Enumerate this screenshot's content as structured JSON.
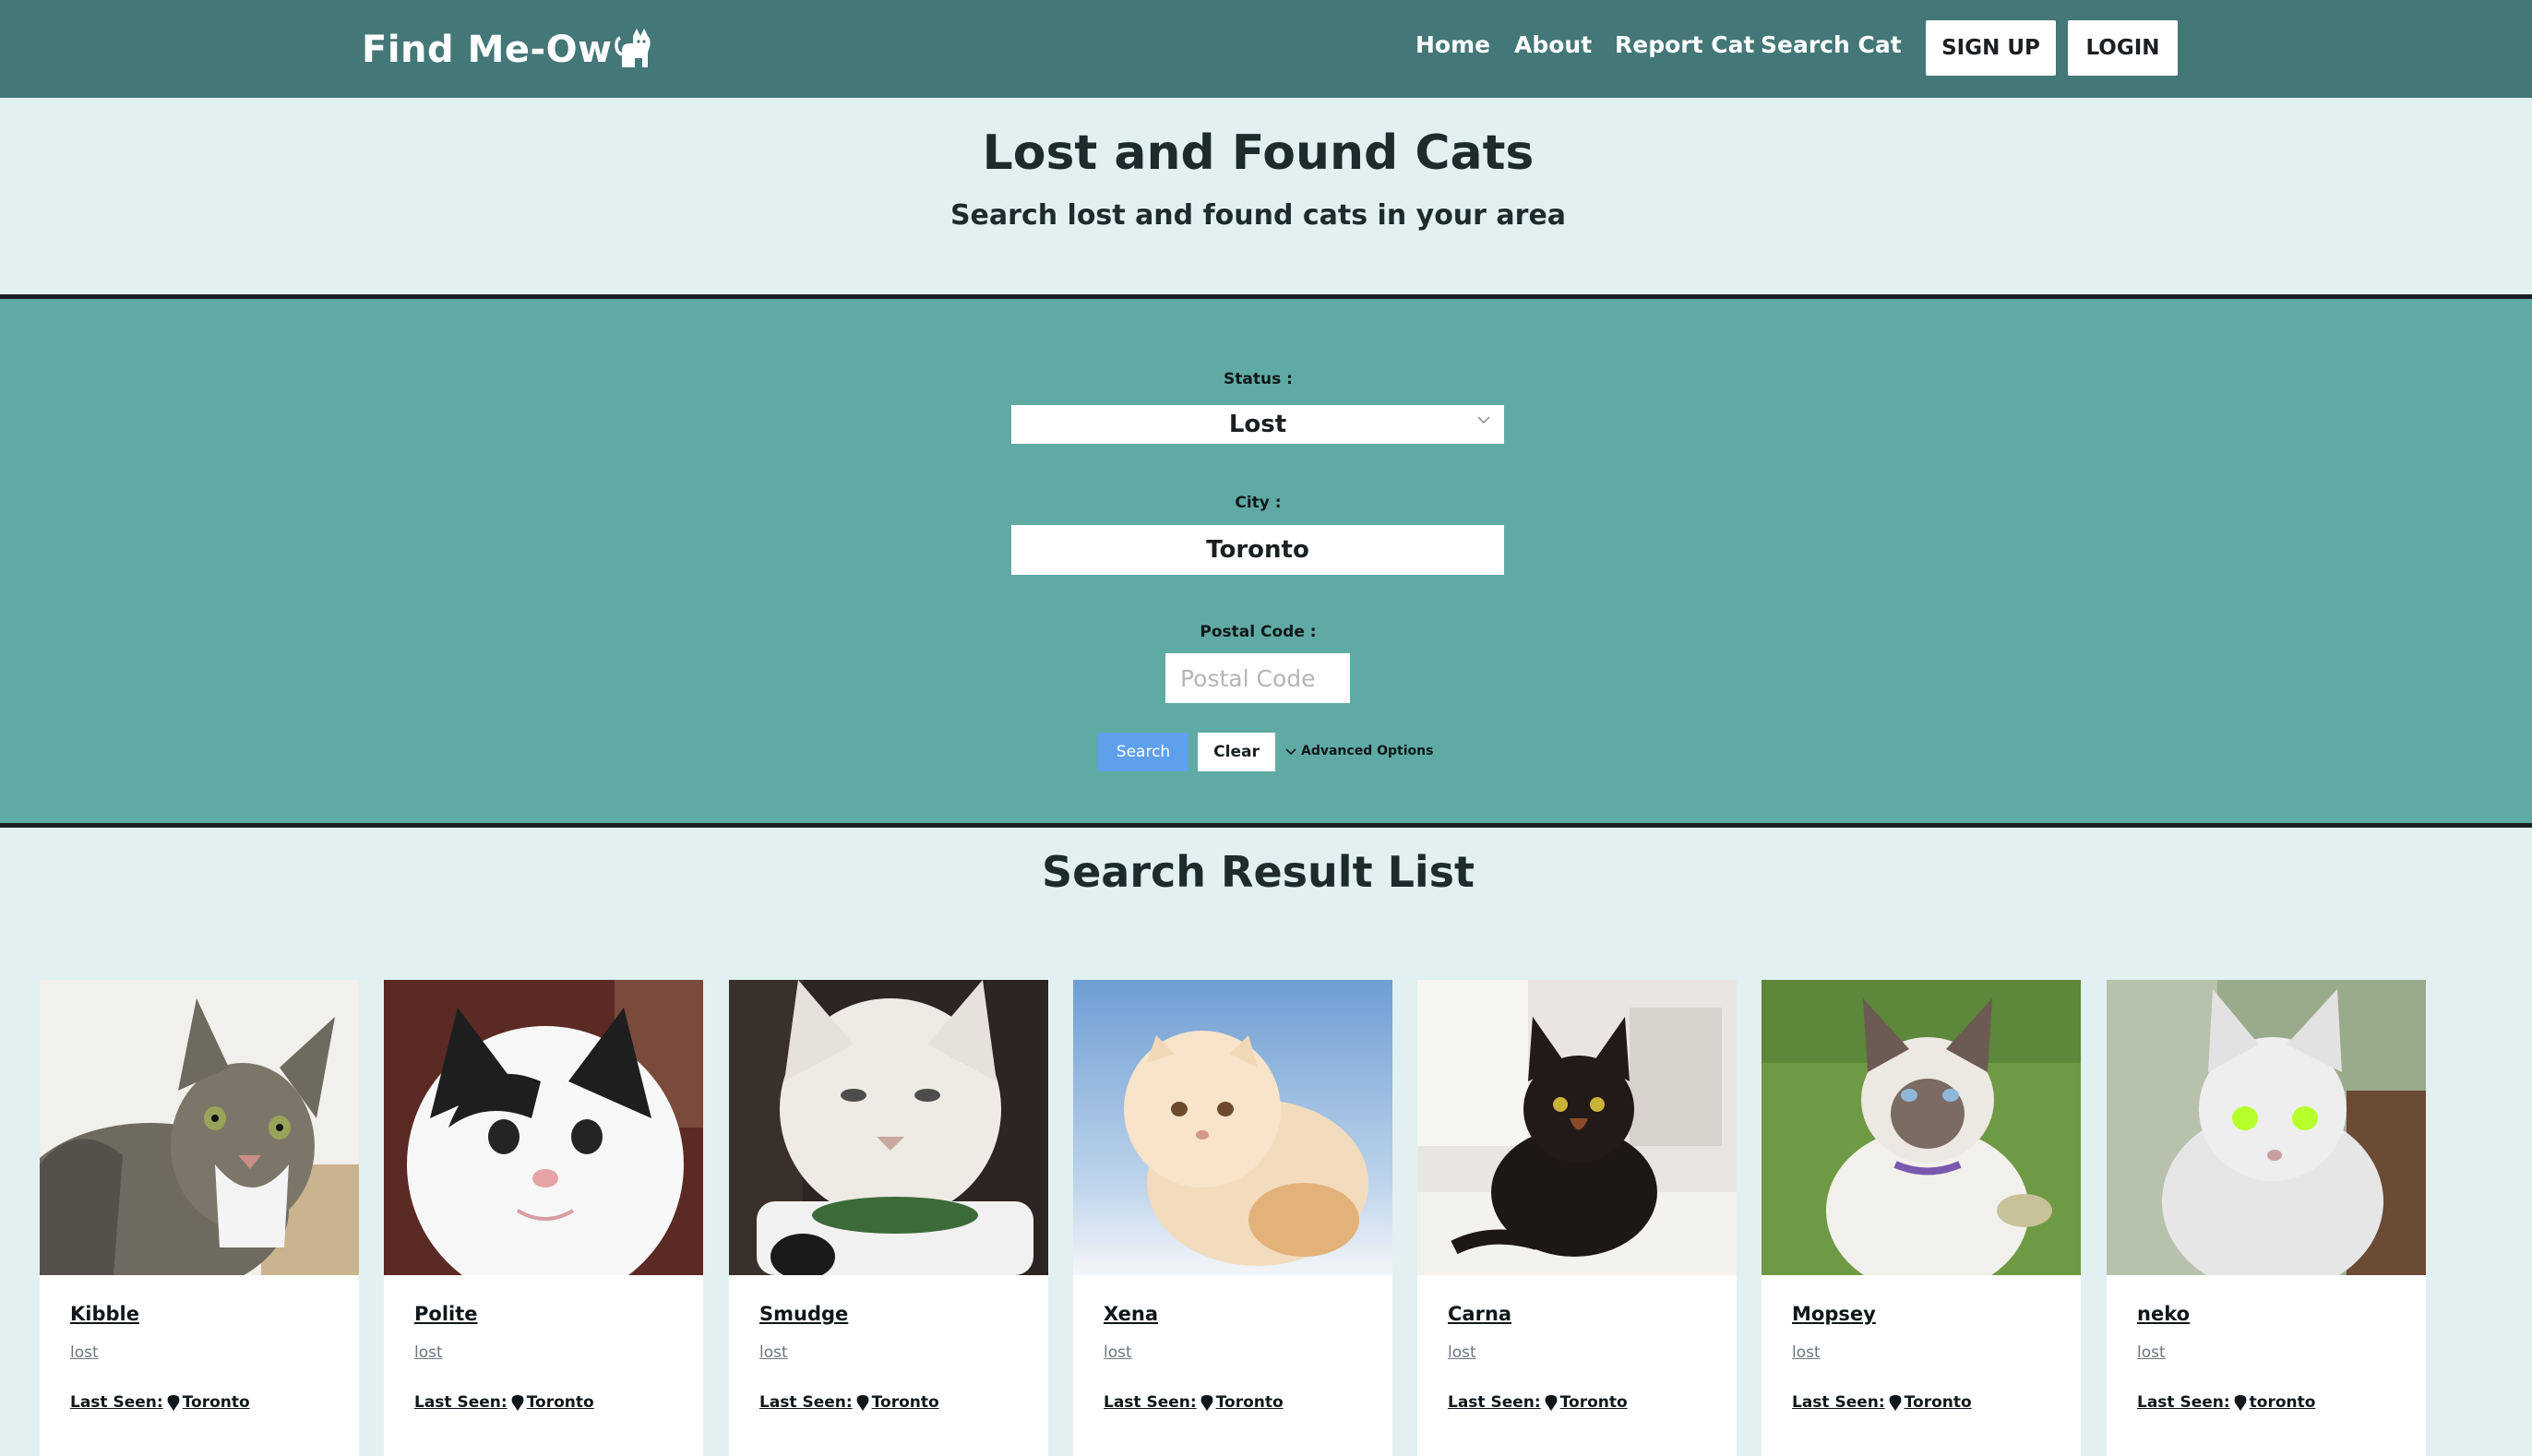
{
  "nav": {
    "logo": "Find Me-Ow",
    "links": [
      "Home",
      "About",
      "Report Cat",
      "Search Cat"
    ],
    "signup": "SIGN UP",
    "login": "LOGIN"
  },
  "hero": {
    "title": "Lost and Found Cats",
    "subtitle": "Search lost and found cats in your area"
  },
  "search": {
    "status_label": "Status :",
    "status_value": "Lost",
    "city_label": "City :",
    "city_value": "Toronto",
    "postal_label": "Postal Code :",
    "postal_placeholder": "Postal Code",
    "search_button": "Search",
    "clear_button": "Clear",
    "advanced": "Advanced Options"
  },
  "results": {
    "title": "Search Result List",
    "last_seen_label": "Last Seen:",
    "cards": [
      {
        "name": "Kibble",
        "status": "lost",
        "city": "Toronto"
      },
      {
        "name": "Polite",
        "status": "lost",
        "city": "Toronto"
      },
      {
        "name": "Smudge",
        "status": "lost",
        "city": "Toronto"
      },
      {
        "name": "Xena",
        "status": "lost",
        "city": "Toronto"
      },
      {
        "name": "Carna",
        "status": "lost",
        "city": "Toronto"
      },
      {
        "name": "Mopsey",
        "status": "lost",
        "city": "Toronto"
      },
      {
        "name": "neko",
        "status": "lost",
        "city": "toronto"
      }
    ]
  },
  "colors": {
    "nav_bg": "#447777",
    "page_bg": "#e1f0f0",
    "search_panel_bg": "#5faaa5",
    "search_button_bg": "#5ea0ec"
  },
  "icons": {
    "logo": "cat-icon",
    "select": "chevron-down-icon",
    "advanced": "chevron-down-icon",
    "location": "map-pin-icon"
  }
}
